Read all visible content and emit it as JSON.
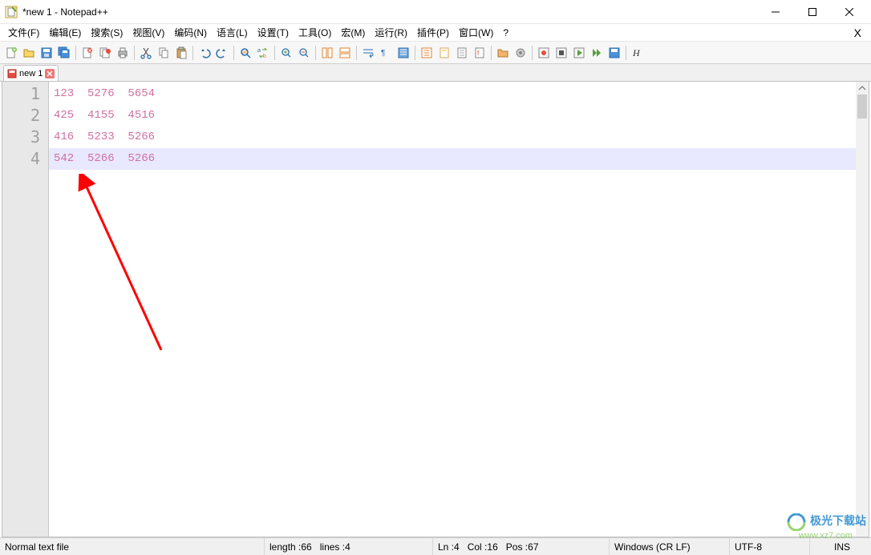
{
  "window": {
    "title": "*new 1 - Notepad++"
  },
  "menu": {
    "items": [
      "文件(F)",
      "编辑(E)",
      "搜索(S)",
      "视图(V)",
      "编码(N)",
      "语言(L)",
      "设置(T)",
      "工具(O)",
      "宏(M)",
      "运行(R)",
      "插件(P)",
      "窗口(W)",
      "?"
    ],
    "close_x": "X"
  },
  "tabs": {
    "active": {
      "label": "new 1"
    }
  },
  "editor": {
    "line_numbers": [
      "1",
      "2",
      "3",
      "4"
    ],
    "lines": [
      "123  5276  5654",
      "425  4155  4516",
      "416  5233  5266",
      "542  5266  5266"
    ],
    "current_line_index": 3
  },
  "statusbar": {
    "filetype": "Normal text file",
    "length_label": "length : ",
    "length_value": "66",
    "lines_label": "lines : ",
    "lines_value": "4",
    "ln_label": "Ln : ",
    "ln_value": "4",
    "col_label": "Col : ",
    "col_value": "16",
    "pos_label": "Pos : ",
    "pos_value": "67",
    "eol": "Windows (CR LF)",
    "encoding": "UTF-8",
    "mode": "INS"
  },
  "watermark": {
    "brand": "极光下载站",
    "url": "www.xz7.com"
  }
}
